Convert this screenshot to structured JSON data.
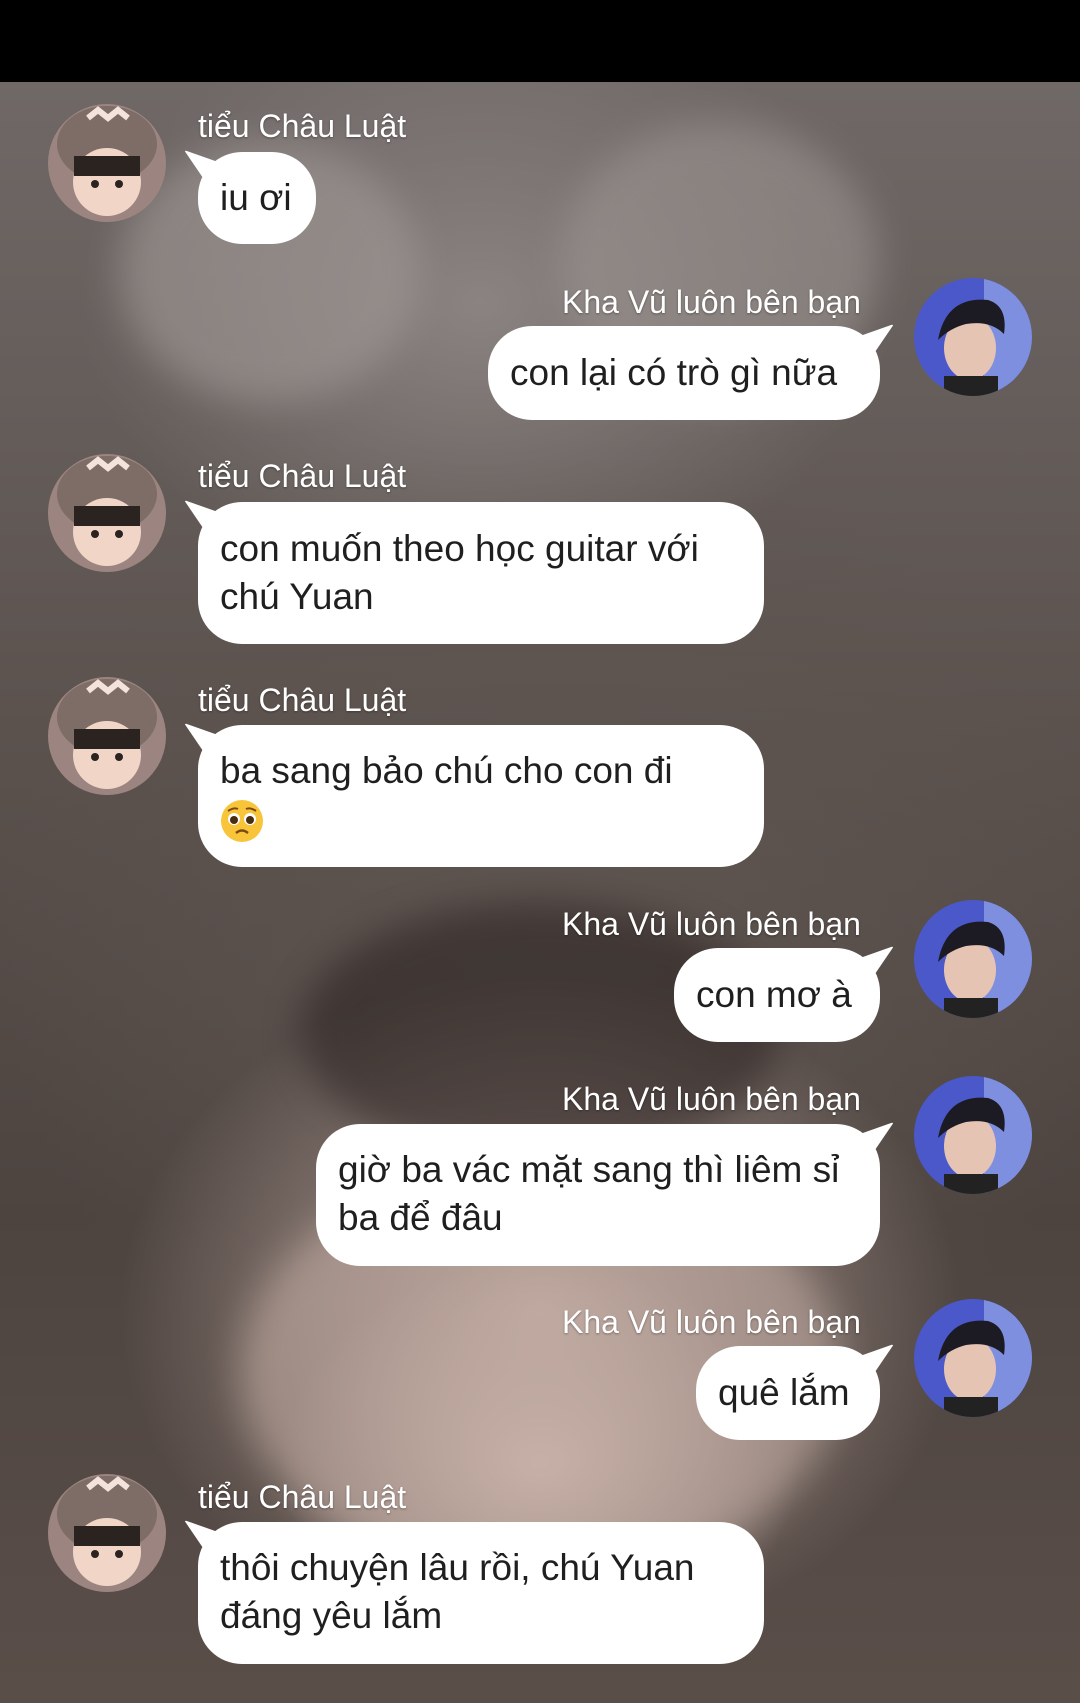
{
  "messages": [
    {
      "sender": "tiểu Châu Luật",
      "side": "left",
      "text": "iu ơi"
    },
    {
      "sender": "Kha Vũ luôn bên bạn",
      "side": "right",
      "text": "con lại có trò gì nữa"
    },
    {
      "sender": "tiểu Châu Luật",
      "side": "left",
      "text": "con muốn theo học guitar với chú Yuan"
    },
    {
      "sender": "tiểu Châu Luật",
      "side": "left",
      "text": "ba sang bảo chú cho con đi",
      "emoji": "pleading-face-icon"
    },
    {
      "sender": "Kha Vũ luôn bên bạn",
      "side": "right",
      "text": "con mơ à"
    },
    {
      "sender": "Kha Vũ luôn bên bạn",
      "side": "right",
      "text": "giờ ba vác mặt sang thì liêm sỉ ba để đâu"
    },
    {
      "sender": "Kha Vũ luôn bên bạn",
      "side": "right",
      "text": "quê lắm"
    },
    {
      "sender": "tiểu Châu Luật",
      "side": "left",
      "text": "thôi chuyện lâu rồi, chú Yuan đáng yêu lắm"
    }
  ],
  "colors": {
    "bubble": "#ffffff",
    "text": "#1f1f1f",
    "name": "#ffffff",
    "statusbar": "#000000"
  }
}
